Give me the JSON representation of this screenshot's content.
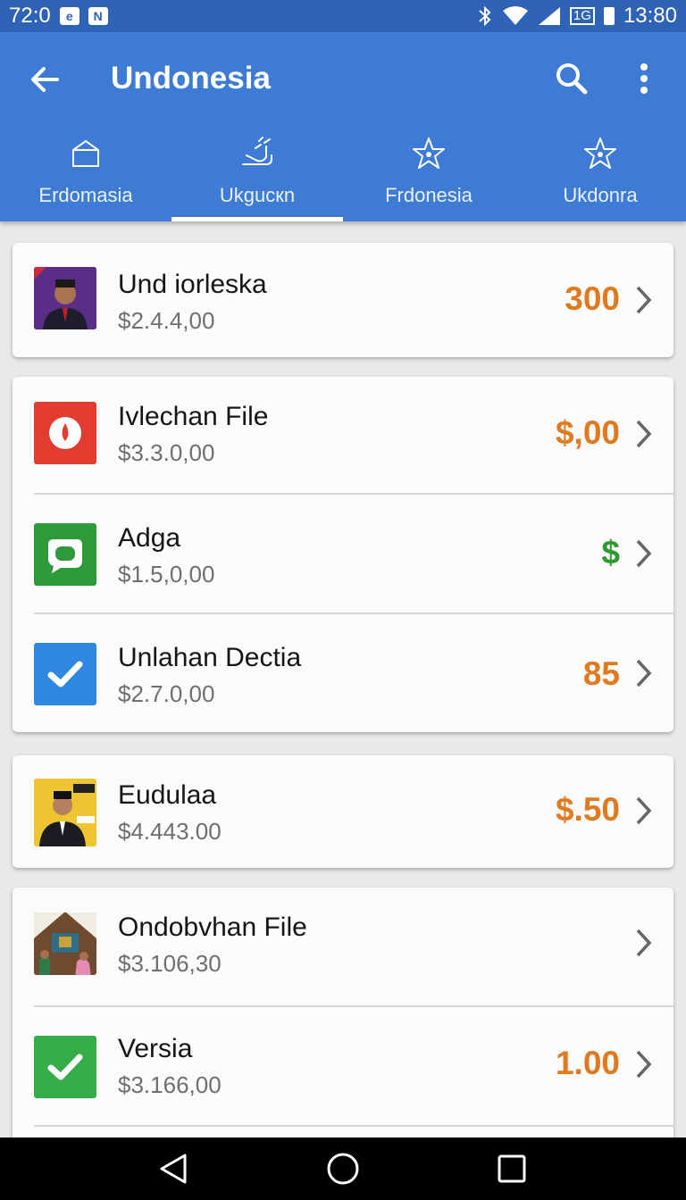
{
  "status_bar": {
    "time_left": "72:0",
    "network": "1G",
    "clock": "13:80",
    "icons": [
      "notification-e-icon",
      "notification-n-icon",
      "bluetooth-icon",
      "wifi-icon",
      "signal-icon",
      "battery-icon"
    ]
  },
  "app_bar": {
    "title": "Undonesia",
    "icons": [
      "back-arrow-icon",
      "search-icon",
      "more-vert-icon"
    ]
  },
  "tabs": [
    {
      "label": "Erdomasia",
      "icon": "house-outline-icon",
      "active": false
    },
    {
      "label": "Ukgucкn",
      "icon": "hand-icon",
      "active": true
    },
    {
      "label": "Frdonesia",
      "icon": "star-icon",
      "active": false
    },
    {
      "label": "Ukdonra",
      "icon": "star-icon",
      "active": false
    }
  ],
  "items": [
    {
      "title": "Und iorleska",
      "subtitle": "$2.4.4,00",
      "value": "300",
      "value_color": "#e07a1f",
      "thumb": "portrait-photo"
    },
    {
      "title": "Ivlechan File",
      "subtitle": "$3.3.0,00",
      "value": "$,00",
      "value_color": "#e07a1f",
      "thumb": "red-drop-icon"
    },
    {
      "title": "Adga",
      "subtitle": "$1.5,0,00",
      "value": "$",
      "value_color": "#2e9a2e",
      "thumb": "green-square-icon"
    },
    {
      "title": "Unlahan Dectia",
      "subtitle": "$2.7.0,00",
      "value": "85",
      "value_color": "#e07a1f",
      "thumb": "blue-check-icon"
    },
    {
      "title": "Eudulaa",
      "subtitle": "$4.443.00",
      "value": "$.50",
      "value_color": "#e07a1f",
      "thumb": "portrait-photo"
    },
    {
      "title": "Ondobvhan File",
      "subtitle": "$3.106,30",
      "value": "",
      "value_color": "#e07a1f",
      "thumb": "scene-photo"
    },
    {
      "title": "Versia",
      "subtitle": "$3.166,00",
      "value": "1.00",
      "value_color": "#e07a1f",
      "thumb": "green-check-icon"
    }
  ],
  "colors": {
    "status_bar": "#2f63b8",
    "app_bar": "#3e7bd4",
    "accent_orange": "#e07a1f",
    "accent_green": "#2e9a2e"
  },
  "nav_bar": {
    "icons": [
      "nav-back-icon",
      "nav-home-icon",
      "nav-recents-icon"
    ]
  }
}
